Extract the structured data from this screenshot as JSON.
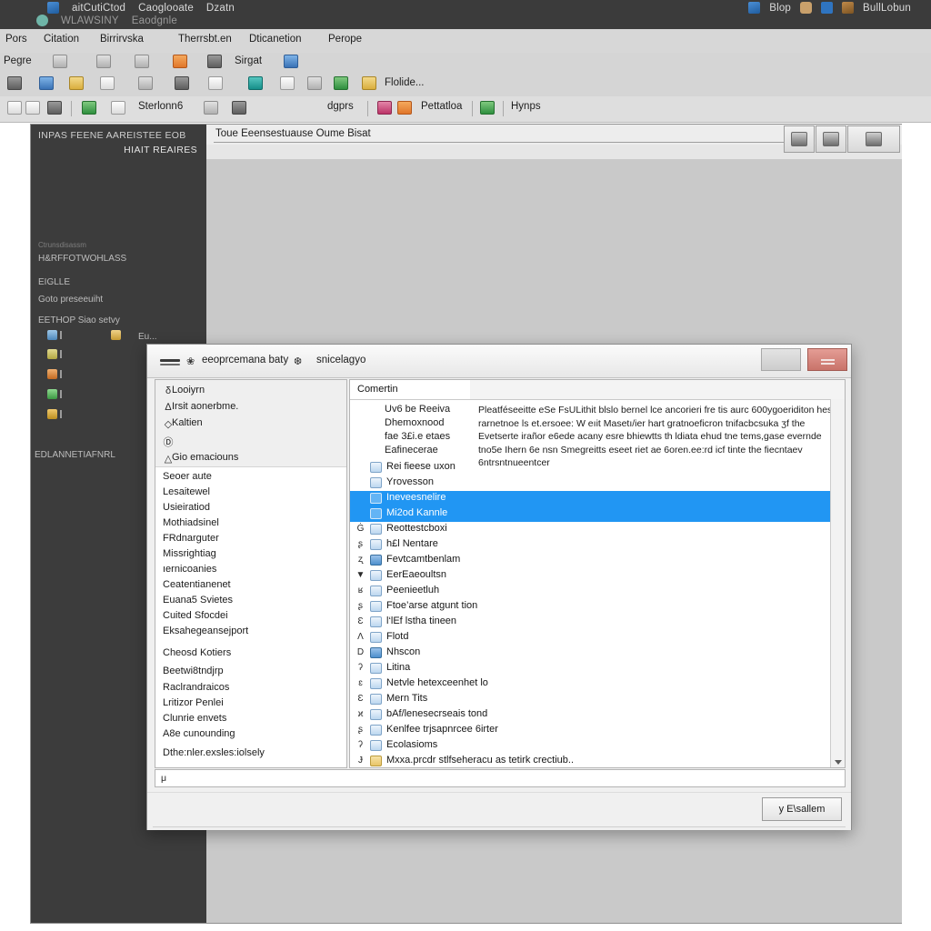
{
  "window": {
    "titlebar": {
      "line1": [
        "aitCutiCtod",
        "Caoglooate",
        "Dzatn"
      ],
      "line2": [
        "WLAWSINY",
        "Eaodgnle"
      ],
      "right": [
        "Blop",
        "BullLobun"
      ],
      "icons": [
        "document-icon",
        "teal-orb-icon",
        "blue-p-icon",
        "brown-book-icon",
        "hand-icon"
      ],
      "background": "#3b3b3b"
    },
    "menubar": {
      "items": [
        "Pors",
        "Citation",
        "Birrirvska",
        "Therrsbt.en",
        "Dticanetion",
        "Perope"
      ]
    },
    "toolbar_row1": [
      {
        "label": "Pegre",
        "icon": "none"
      },
      {
        "label": "",
        "icon": "grid-icon"
      },
      {
        "label": "",
        "icon": "table-icon"
      },
      {
        "label": "",
        "icon": "window-icon"
      },
      {
        "label": "",
        "icon": "orange-layers-icon"
      },
      {
        "label": "",
        "icon": "gray-card-icon"
      },
      {
        "label": "Sirgat",
        "icon": "none"
      },
      {
        "label": "",
        "icon": "blue-columns-icon"
      }
    ],
    "toolbar_row2": [
      {
        "label": "",
        "icon": "printer-icon"
      },
      {
        "label": "",
        "icon": "globe-icon"
      },
      {
        "label": "",
        "icon": "yellow-person-icon"
      },
      {
        "label": "",
        "icon": "chart-icon"
      },
      {
        "label": "",
        "icon": "calendar-icon"
      },
      {
        "label": "",
        "icon": "wrench-icon"
      },
      {
        "label": "",
        "icon": "search-icon"
      },
      {
        "label": "",
        "icon": "teal-grid-icon"
      },
      {
        "label": "",
        "icon": "tag-icon"
      },
      {
        "label": "",
        "icon": "trend-icon"
      },
      {
        "label": "",
        "icon": "green-chart-icon"
      },
      {
        "label": "Flolide...",
        "icon": "yellow-folder-icon"
      }
    ],
    "toolbar2": [
      {
        "label": "",
        "icon": "page-icon"
      },
      {
        "label": "",
        "icon": "list-icon"
      },
      {
        "label": "",
        "icon": "db-icon"
      },
      {
        "label": "",
        "icon": "green-sheet-icon"
      },
      {
        "label": "",
        "icon": "paint-icon"
      },
      {
        "label": "Sterlonn6",
        "icon": "none"
      },
      {
        "label": "",
        "icon": "cloud-icon"
      },
      {
        "label": "",
        "icon": "clock-icon"
      },
      {
        "label": "",
        "icon": "cursor-icon"
      },
      {
        "label": "",
        "icon": "menu-lines-icon"
      },
      {
        "label": "dgprs",
        "icon": "none"
      },
      {
        "label": "",
        "icon": "pink-globe-icon"
      },
      {
        "label": "",
        "icon": "orange-person-icon"
      },
      {
        "label": "Pettatloa",
        "icon": "none"
      },
      {
        "label": "",
        "icon": "green-cube-icon"
      },
      {
        "label": "Hynps",
        "icon": "none"
      },
      {
        "label": "",
        "icon": "flag-icon"
      }
    ]
  },
  "sidebar": {
    "title": "INPAS FEENE  AAREISTEE EOB",
    "subtitle": "HIAIT REAIRES",
    "rows": [
      {
        "text": "Ctrunsdisassm",
        "dim": true
      },
      {
        "text": "H&RFFOTWOHLASS"
      },
      {
        "text": "EIGLLE"
      },
      {
        "text": "Goto preseeuiht"
      },
      {
        "text": "EETHOP Siao setvy"
      },
      {
        "text": "Eu..."
      }
    ],
    "footer": "EDLANNETIAFNRL",
    "icons": [
      "blue-tile-icon",
      "yellow-tile-icon",
      "orange-tile-icon",
      "green-tile-icon",
      "gold-tile-icon"
    ]
  },
  "document": {
    "heading": "Toue Eeensestuause Oume Bisat",
    "header_buttons": [
      "print-preview-button",
      "person-button",
      "scan-button"
    ]
  },
  "dialog": {
    "title_part1": "eeoprcemana baty",
    "title_part2": "snicelagyo",
    "title_glyph1": "❀",
    "title_glyph2": "❆",
    "window_buttons": {
      "minimize": "minimize-button",
      "close": "close-button"
    },
    "left_panel": {
      "header_items": [
        {
          "glyph": "δ",
          "label": "Looiyrn"
        },
        {
          "glyph": "∆",
          "label": "Irsit aonerbme."
        },
        {
          "glyph": "◇",
          "label": "Kaltien"
        },
        {
          "glyph": "Ⓓ",
          "label": ""
        },
        {
          "glyph": "△",
          "label": "Gio emaciouns"
        }
      ],
      "items": [
        "Seoer aute",
        "Lesaitewel",
        "Usieiratiod",
        "Mothiadsinel",
        "FRdnarguter",
        "Missrightiag",
        "ıernicoanies",
        "Ceatentianenet",
        "Euana5 Svietes",
        "Cuited Sfocdei",
        "Eksahegeansejport",
        "Cheosd Kotiers",
        "Beetwi8tndjrp",
        "Raclrandraicos",
        "Lritizor Penlei",
        "Clunrie envets",
        "A8e cunounding",
        "Dthe:nler.exsles:iolsely"
      ]
    },
    "right_panel": {
      "column_header": "Comertin",
      "description": "Pleatféseeitte eSe FsULithit blslo bernel lce ancorieri fre tis aurc 600ygoeriditon hes rarnetnoe ls et.ersoee: W eıit Masetı/ier hart gratnoeficron tnifacbcsuka ʒf the Evetserte irañor e6ede acany esre bhiewtts th ldiata ehud tne tems,gase evernde tno5e Ihern 6e nsn Smegreitts eseet riet ae 6oren.ee:rd icf tinte the fiecntaev 6ntrsntnueentcer",
      "plain_rows": [
        "Uv6 be Reeiva",
        "Dhemoxnood",
        "fae 3£i.e etaes",
        "Eafinecerae"
      ],
      "rows": [
        {
          "glyph": "",
          "icon": "list-icon",
          "label": "Rei fieese uxon",
          "selected": false
        },
        {
          "glyph": "",
          "icon": "grid-icon",
          "label": "Yrovesson",
          "selected": false
        },
        {
          "glyph": "",
          "icon": "lines-icon",
          "label": "Ineveesnelire",
          "selected": true
        },
        {
          "glyph": "",
          "icon": "swirl-icon",
          "label": "Mi2od Kannle",
          "selected": true
        },
        {
          "glyph": "Ġ",
          "icon": "tile-icon",
          "label": "Reottestcboxi",
          "selected": false
        },
        {
          "glyph": "ʂ",
          "icon": "doc-icon",
          "label": "h£l Nentare",
          "selected": false
        },
        {
          "glyph": "ʐ",
          "icon": "solid-icon",
          "label": "Fevtcamtbenlam",
          "selected": false
        },
        {
          "glyph": "▼",
          "icon": "frame-icon",
          "label": "EerEaeoultsn",
          "selected": false
        },
        {
          "glyph": "ʁ",
          "icon": "panel-icon",
          "label": "Peenieetluh",
          "selected": false
        },
        {
          "glyph": "ʂ",
          "icon": "win-icon",
          "label": "Ftoe’arse atgunt tion",
          "selected": false
        },
        {
          "glyph": "Ɛ",
          "icon": "face-icon",
          "label": "l‘lEf lstha tineen",
          "selected": false
        },
        {
          "glyph": "Ʌ",
          "icon": "card-icon",
          "label": "Flotd",
          "selected": false
        },
        {
          "glyph": "D",
          "icon": "solid-icon",
          "label": "Nhscon",
          "selected": false
        },
        {
          "glyph": "ʔ",
          "icon": "card-icon",
          "label": "Litina",
          "selected": false
        },
        {
          "glyph": "ɛ",
          "icon": "pen-icon",
          "label": "Netvle hetexceenhet lo",
          "selected": false
        },
        {
          "glyph": "Ɛ",
          "icon": "card-icon",
          "label": "Mern Tits",
          "selected": false
        },
        {
          "glyph": "ϰ",
          "icon": "card-icon",
          "label": "bAf/lenesecrseais tond",
          "selected": false
        },
        {
          "glyph": "ʂ",
          "icon": "frame-icon",
          "label": "Kenlfee trjsapnrcee 6irter",
          "selected": false
        },
        {
          "glyph": "ʔ",
          "icon": "bracket-icon",
          "label": "Ecolasioms",
          "selected": false
        },
        {
          "glyph": "Ɉ",
          "icon": "folder-icon",
          "label": "Mxxa.prcdr stlfseheracu as tetirk crectiub..",
          "selected": false
        }
      ]
    },
    "status_line": "μ",
    "footer_button": "у E\\sallem"
  },
  "colors": {
    "selection": "#2196f3",
    "titlebar": "#3b3b3b",
    "sidebar": "#3c3c3c",
    "close_button": "#c9736a"
  }
}
